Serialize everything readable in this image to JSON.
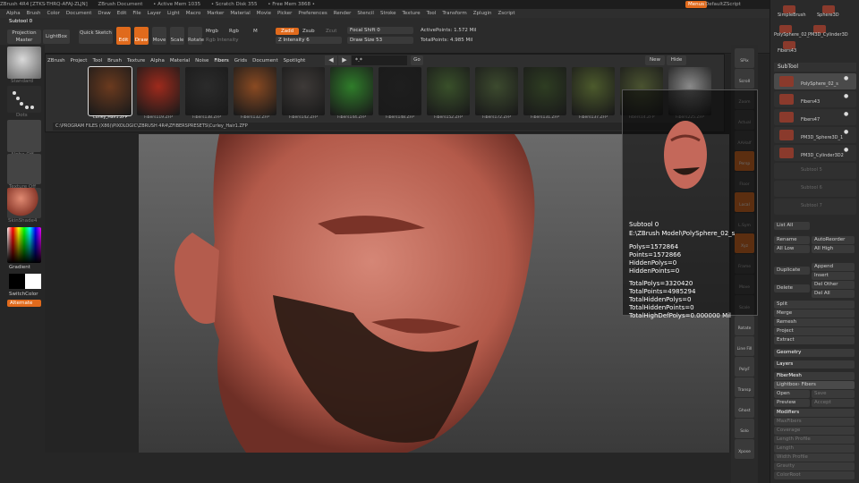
{
  "titlebar": {
    "app": "ZBrush 4R4 [ZTKS-THRQ-AFAJ-ZLJN]",
    "doc": "ZBrush Document",
    "active_mem": "• Active Mem 1035",
    "scratch": "• Scratch Disk 355",
    "free_mem": "• Free Mem 3868 •",
    "menus_label": "Menus",
    "script_label": "DefaultZScript"
  },
  "menubar": [
    "Alpha",
    "Brush",
    "Color",
    "Document",
    "Draw",
    "Edit",
    "File",
    "Layer",
    "Light",
    "Macro",
    "Marker",
    "Material",
    "Movie",
    "Picker",
    "Preferences",
    "Render",
    "Stencil",
    "Stroke",
    "Texture",
    "Tool",
    "Transform",
    "Zplugin",
    "Zscript"
  ],
  "topshelf": {
    "subtool": "Subtool 0",
    "projection_master": "Projection Master",
    "lightbox": "LightBox",
    "quick_sketch": "Quick Sketch",
    "edit": "Edit",
    "draw": "Draw",
    "move": "Move",
    "scale": "Scale",
    "rotate": "Rotate",
    "mrgb": "Mrgb",
    "rgb": "Rgb",
    "m": "M",
    "rgb_intensity": "Rgb Intensity",
    "zadd": "Zadd",
    "zsub": "Zsub",
    "zcut": "Zcut",
    "z_intensity": "Z Intensity 6",
    "focal_shift": "Focal Shift 0",
    "draw_size": "Draw Size 53",
    "active_points": "ActivePoints: 1.572 Mil",
    "total_points": "TotalPoints: 4.985 Mil"
  },
  "leftpanel": {
    "brush_label": "Standard",
    "stroke_label": "Dots",
    "alpha_label": "Alpha Off",
    "texture_label": "Texture Off",
    "material_label": "SkinShade4",
    "gradient": "Gradient",
    "switch_color": "SwitchColor",
    "alternate": "Alternate"
  },
  "lightbox": {
    "tabs": [
      "ZBrush",
      "Project",
      "Tool",
      "Brush",
      "Texture",
      "Alpha",
      "Material",
      "Noise",
      "Fibers",
      "Grids",
      "Document",
      "Spotlight"
    ],
    "active_tab": "Fibers",
    "search_placeholder": "*.*",
    "go": "Go",
    "new": "New",
    "hide": "Hide",
    "path": "C:\\PROGRAM FILES (X86)\\PIXOLOGIC\\ZBRUSH 4R4\\ZFIBERSPRESETS\\Curley_Hair1.ZFP",
    "items": [
      {
        "label": "Curley_Hair1.ZFP",
        "color": "#6b3a1e"
      },
      {
        "label": "Fibers119.ZFP",
        "color": "#9e2a1c"
      },
      {
        "label": "Fibers138.ZFP",
        "color": "#2b2b2b"
      },
      {
        "label": "Fibers132.ZFP",
        "color": "#8a4a22"
      },
      {
        "label": "Fibers142.ZFP",
        "color": "#3e3a38"
      },
      {
        "label": "Fibers144.ZFP",
        "color": "#2f7d2a"
      },
      {
        "label": "Fibers148.ZFP",
        "color": "#1e1e1e"
      },
      {
        "label": "Fibers152.ZFP",
        "color": "#39502a"
      },
      {
        "label": "Fibers172.ZFP",
        "color": "#3c4a2e"
      },
      {
        "label": "Fibers131.ZFP",
        "color": "#2e3d22"
      },
      {
        "label": "Fibers137.ZFP",
        "color": "#4c5a2c"
      },
      {
        "label": "Fibers14.ZFP",
        "color": "#4a5330"
      },
      {
        "label": "Fibers225.ZFP",
        "color": "#8a8a8a"
      }
    ]
  },
  "rightshelf": [
    "SPix",
    "Scroll",
    "Zoom",
    "Actual",
    "AAHalf",
    "Persp",
    "Floor",
    "Local",
    "L.Sym",
    "Xyz",
    "Frame",
    "Move",
    "Scale",
    "Rotate",
    "Line Fill",
    "PolyF",
    "Transp",
    "Ghost",
    "Solo",
    "Xpose"
  ],
  "info": {
    "subtool": "Subtool 0",
    "path": "E:\\ZBrush Model\\PolySphere_02_s",
    "polys": "Polys=1572864",
    "points": "Points=1572866",
    "hidden_polys": "HiddenPolys=0",
    "hidden_points": "HiddenPoints=0",
    "total_polys": "TotalPolys=3320420",
    "total_points": "TotalPoints=4985294",
    "total_hidden_polys": "TotalHiddenPolys=0",
    "total_hidden_points": "TotalHiddenPoints=0",
    "total_hd_polys": "TotalHighDefPolys=0.000000 Mil"
  },
  "tray": {
    "tools": [
      "SimpleBrush",
      "Sphere3D",
      "PolySphere_02_",
      "PM3D_Cylinder3D",
      "Fibers43"
    ],
    "subtool_header": "SubTool",
    "subtools": [
      "PolySphere_02_s",
      "Fibers43",
      "Fibers47",
      "PM3D_Sphere3D_1",
      "PM3D_Cylinder3D2",
      "Subtool 5",
      "Subtool 6",
      "Subtool 7"
    ],
    "list_all": "List All",
    "rename": "Rename",
    "auto_reorder": "AutoReorder",
    "all_low": "All Low",
    "all_high": "All High",
    "duplicate": "Duplicate",
    "append": "Append",
    "insert": "Insert",
    "delete": "Delete",
    "del_other": "Del Other",
    "del_all": "Del All",
    "split": "Split",
    "merge": "Merge",
    "remesh": "Remesh",
    "project": "Project",
    "extract": "Extract",
    "geometry": "Geometry",
    "layers": "Layers",
    "fibermesh": "FiberMesh",
    "lightbox_fibers": "Lightbox› Fibers",
    "open": "Open",
    "save": "Save",
    "preview": "Preview",
    "accept": "Accept",
    "modifiers": "Modifiers",
    "max_fibers": "MaxFibers",
    "by_area": "ByArea",
    "coverage": "Coverage",
    "length": "Length",
    "length_profile": "Length Profile",
    "width": "Width",
    "width_profile": "Width Profile",
    "gravity": "Gravity",
    "color": "ColorRoot"
  }
}
